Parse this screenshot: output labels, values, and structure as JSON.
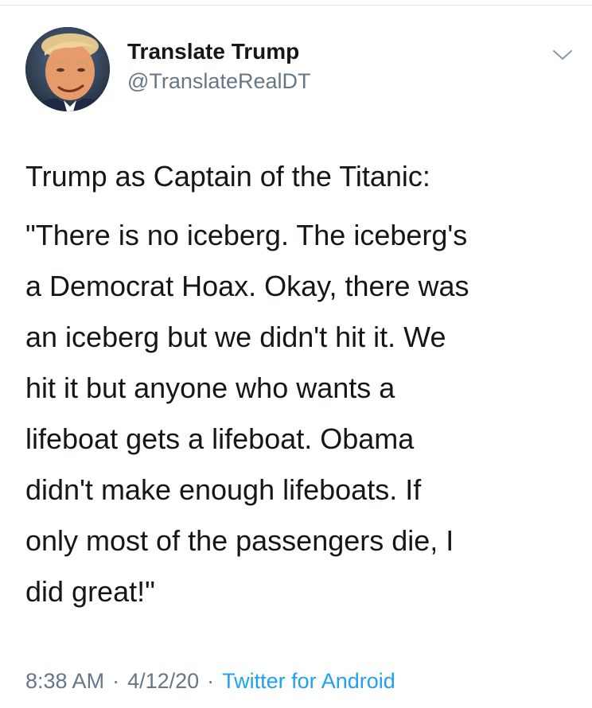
{
  "tweet": {
    "author": {
      "display_name": "Translate Trump",
      "handle": "@TranslateRealDT",
      "avatar_icon": "profile-photo"
    },
    "menu_icon": "chevron-down-icon",
    "text": {
      "heading": "Trump as Captain of the Titanic:",
      "lines": [
        "\"There is no iceberg. The iceberg's",
        "a Democrat Hoax. Okay, there was",
        "an iceberg but we didn't hit it. We",
        "hit it but anyone who wants a",
        "lifeboat gets a lifeboat. Obama",
        "didn't make enough lifeboats. If",
        "only most of the passengers die, I",
        "did great!\""
      ]
    },
    "meta": {
      "time": "8:38 AM",
      "separator": "·",
      "date": "4/12/20",
      "source": "Twitter for Android"
    }
  },
  "colors": {
    "text": "#14171a",
    "secondary": "#657786",
    "link": "#1da1f2",
    "divider": "#e1e8ed"
  }
}
